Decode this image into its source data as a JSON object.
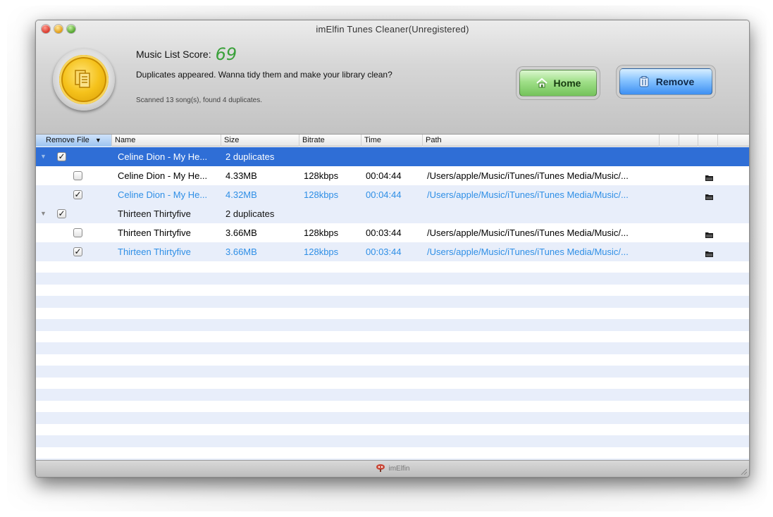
{
  "window": {
    "title": "imElfin Tunes Cleaner(Unregistered)"
  },
  "summary": {
    "score_label": "Music List Score:",
    "score_value": "69",
    "message": "Duplicates appeared. Wanna tidy them and make your library clean?",
    "scan_info": "Scanned 13 song(s), found 4 duplicates."
  },
  "buttons": {
    "home": "Home",
    "remove": "Remove"
  },
  "columns": [
    "Remove File",
    "Name",
    "Size",
    "Bitrate",
    "Time",
    "Path"
  ],
  "groups": [
    {
      "name": "Celine Dion - My He...",
      "count": "2 duplicates",
      "checked": true,
      "items": [
        {
          "name": "Celine Dion - My He...",
          "size": "4.33MB",
          "bitrate": "128kbps",
          "time": "00:04:44",
          "path": "/Users/apple/Music/iTunes/iTunes Media/Music/...",
          "checked": false
        },
        {
          "name": "Celine Dion - My He...",
          "size": "4.32MB",
          "bitrate": "128kbps",
          "time": "00:04:44",
          "path": "/Users/apple/Music/iTunes/iTunes Media/Music/...",
          "checked": true
        }
      ]
    },
    {
      "name": "Thirteen Thirtyfive",
      "count": "2 duplicates",
      "checked": true,
      "items": [
        {
          "name": "Thirteen Thirtyfive",
          "size": "3.66MB",
          "bitrate": "128kbps",
          "time": "00:03:44",
          "path": "/Users/apple/Music/iTunes/iTunes Media/Music/...",
          "checked": false
        },
        {
          "name": "Thirteen Thirtyfive",
          "size": "3.66MB",
          "bitrate": "128kbps",
          "time": "00:03:44",
          "path": "/Users/apple/Music/iTunes/iTunes Media/Music/...",
          "checked": true
        }
      ]
    }
  ],
  "footer": {
    "brand": "imElfin"
  },
  "colors": {
    "selection": "#2f6ed6",
    "checked_text": "#2f8fe6",
    "score": "#3aa13a",
    "stripe": "#e8eefa"
  },
  "icons": {
    "home": "house-icon",
    "remove": "trash-icon",
    "open": "folder-icon",
    "logo": "documents-coin-icon"
  }
}
